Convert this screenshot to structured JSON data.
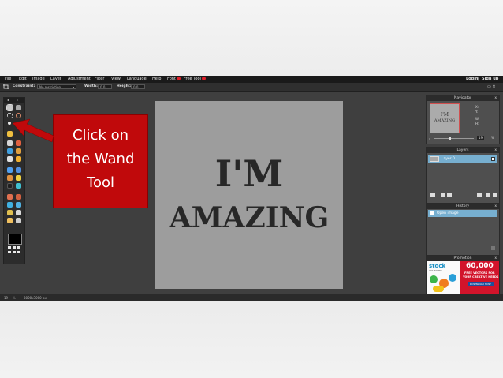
{
  "menubar": {
    "items": [
      "File",
      "Edit",
      "Image",
      "Layer",
      "Adjustment",
      "Filter",
      "View",
      "Language",
      "Help",
      "Font",
      "Free Tool"
    ],
    "login": "Login",
    "separator": "|",
    "signup": "Sign up"
  },
  "options_bar": {
    "constraint_label": "Constraint:",
    "constraint_value": "No restriction",
    "width_label": "Width:",
    "width_value": "0.0",
    "height_label": "Height:",
    "height_value": "0.0"
  },
  "callout": {
    "line1": "Click on",
    "line2": "the Wand",
    "line3": "Tool",
    "color": "#c0090b"
  },
  "canvas": {
    "line1": "I'M",
    "line2": "AMAZING",
    "background": "#9d9d9d"
  },
  "navigator": {
    "title": "Navigator",
    "close": "x",
    "thumb_line1": "I'M",
    "thumb_line2": "AMAZING",
    "x_label": "X:",
    "y_label": "Y:",
    "w_label": "W:",
    "h_label": "H:",
    "zoom_value": "19"
  },
  "layers": {
    "title": "Layers",
    "close": "x",
    "layer_name": "Layer 0"
  },
  "history": {
    "title": "History",
    "close": "x",
    "item": "Open image"
  },
  "promotion": {
    "title": "Promotion",
    "close": "x",
    "brand": "stock",
    "brand_sub": "UNLIMITED",
    "headline": "60,000",
    "line1": "FREE VECTORS FOR",
    "line2": "YOUR CREATIVE NEEDS",
    "button": "DOWNLOAD NOW"
  },
  "status": {
    "zoom": "19",
    "dimensions": "3000x3000 px"
  },
  "colors": {
    "selection_blue": "#77afd0",
    "badge_red": "#e0202a"
  }
}
